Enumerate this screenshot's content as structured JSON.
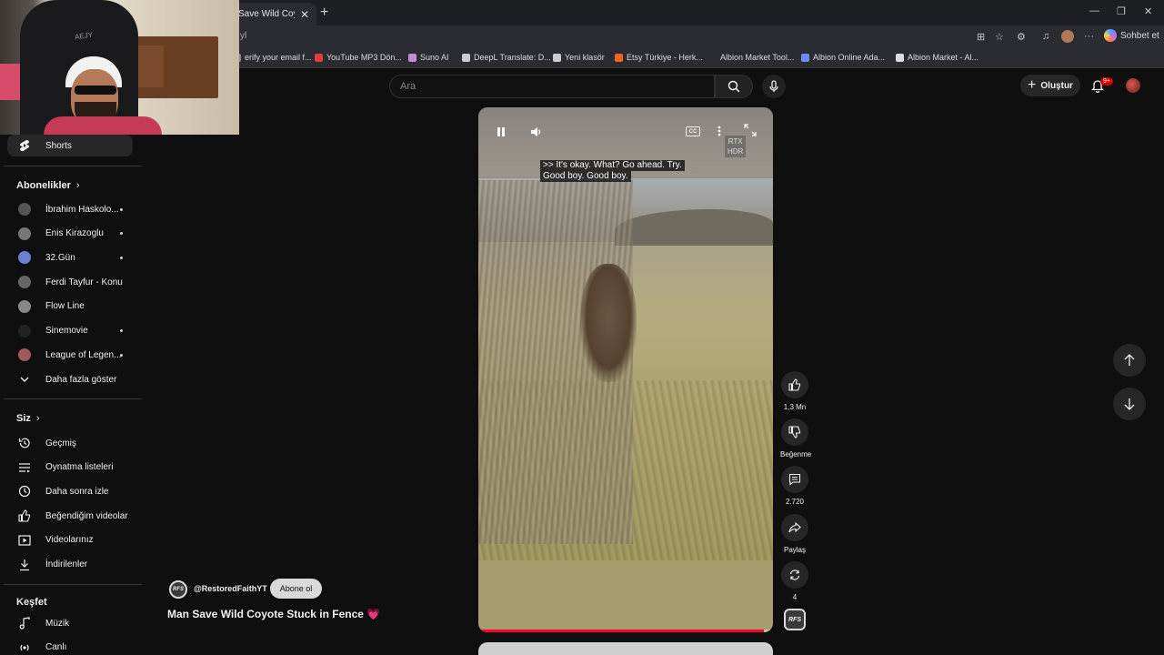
{
  "browser": {
    "tab_title": "Save Wild Coyote S",
    "url_fragment": "yl",
    "chat_label": "Sohbet et",
    "bookmarks": [
      {
        "label": "erify your email f...",
        "color": "#888888"
      },
      {
        "label": "YouTube MP3 Dön...",
        "color": "#e23b3b"
      },
      {
        "label": "Suno AI",
        "color": "#c88bd8"
      },
      {
        "label": "DeepL Translate: D...",
        "color": "#cccccc"
      },
      {
        "label": "Yeni klasör",
        "color": "#cccccc"
      },
      {
        "label": "Etsy Türkiye - Herk...",
        "color": "#f16521"
      },
      {
        "label": "Albion Market Tool...",
        "color": "#2b2c31"
      },
      {
        "label": "Albion Online Ada...",
        "color": "#6b8cff"
      },
      {
        "label": "Albion Market - Al...",
        "color": "#dddddd"
      }
    ]
  },
  "header": {
    "search_placeholder": "Ara",
    "create_label": "Oluştur",
    "notification_count": "9+"
  },
  "webcam": {
    "chair_logo": "AEJY"
  },
  "sidebar": {
    "shorts_label": "Shorts",
    "subscriptions_title": "Abonelikler",
    "subscriptions": [
      {
        "label": "İbrahim Haskolo...",
        "new": true,
        "color": "#555555"
      },
      {
        "label": "Enis Kirazoglu",
        "new": true,
        "color": "#777777"
      },
      {
        "label": "32.Gün",
        "new": true,
        "color": "#6a7fd0"
      },
      {
        "label": "Ferdi Tayfur - Konu",
        "new": false,
        "color": "#666666"
      },
      {
        "label": "Flow Line",
        "new": false,
        "color": "#888888"
      },
      {
        "label": "Sinemovie",
        "new": true,
        "color": "#222222"
      },
      {
        "label": "League of Legen...",
        "new": true,
        "color": "#a05a5a"
      }
    ],
    "show_more_label": "Daha fazla göster",
    "you_title": "Siz",
    "you_items": [
      "Geçmiş",
      "Oynatma listeleri",
      "Daha sonra izle",
      "Beğendiğim videolar",
      "Videolarınız",
      "İndirilenler"
    ],
    "explore_title": "Keşfet",
    "explore_items": [
      "Müzik",
      "Canlı"
    ]
  },
  "player": {
    "captions": [
      ">> It's okay. What? Go ahead. Try.",
      "Good boy. Good boy."
    ],
    "cc_label": "CC",
    "rtx_line1": "RTX",
    "rtx_line2": "HDR",
    "progress": 0.97
  },
  "actions": {
    "like_count": "1,3 Mn",
    "dislike_label": "Beğenme",
    "comment_count": "2.720",
    "share_label": "Paylaş",
    "remix_count": "4"
  },
  "video": {
    "channel_avatar_text": "RFS",
    "channel_name": "@RestoredFaithYT",
    "subscribe_label": "Abone ol",
    "title": "Man Save Wild Coyote Stuck in Fence 💗"
  }
}
